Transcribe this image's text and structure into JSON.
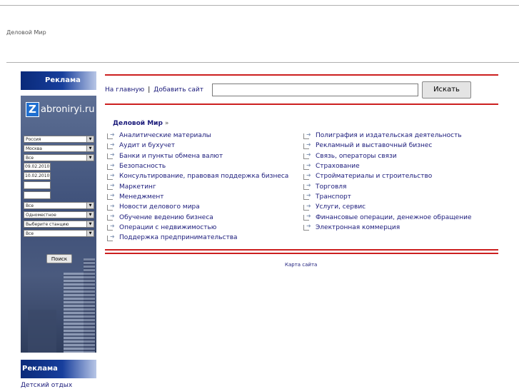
{
  "site_title": "Деловой Мир",
  "sidebar": {
    "ad_heading": "Реклама",
    "widget": {
      "logo_letter": "Z",
      "logo_text": "abroniryi.ru",
      "selects": [
        "Россия",
        "Москва",
        "Все"
      ],
      "date_from": "09.02.2010",
      "date_to": "10.02.2010",
      "empty_inputs": [
        "",
        ""
      ],
      "selects2": [
        "Все",
        "Одноместное",
        "Выберите станцию",
        "Все"
      ],
      "search_button": "Поиск"
    },
    "ad_heading2": "Реклама",
    "link_kids": "Детский отдых"
  },
  "nav": {
    "home": "На главную",
    "separator": "|",
    "add_site": "Добавить сайт",
    "search_placeholder": "",
    "search_button": "Искать"
  },
  "catalog": {
    "title": "Деловой Мир",
    "raquo": "»",
    "left": [
      "Аналитические материалы",
      "Аудит и бухучет",
      "Банки и пункты обмена валют",
      "Безопасность",
      "Консультирование, правовая поддержка бизнеса",
      "Маркетинг",
      "Менеджмент",
      "Новости делового мира",
      "Обучение ведению бизнеса",
      "Операции с недвижимостью",
      "Поддержка предпринимательства"
    ],
    "right": [
      "Полиграфия и издательская деятельность",
      "Рекламный и выставочный бизнес",
      "Связь, операторы связи",
      "Страхование",
      "Стройматериалы и строительство",
      "Торговля",
      "Транспорт",
      "Услуги, сервис",
      "Финансовые операции, денежное обращение",
      "Электронная коммерция"
    ]
  },
  "footer": {
    "sitemap": "Карта сайта"
  },
  "colors": {
    "accent_red": "#cc1f1f",
    "link": "#1a1a7a",
    "ad_blue": "#0a2a7a"
  }
}
